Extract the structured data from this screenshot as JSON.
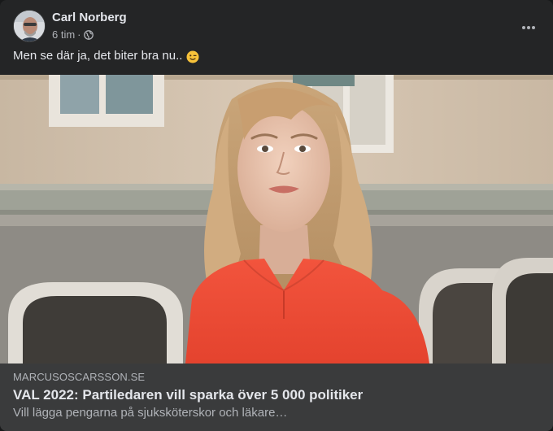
{
  "post": {
    "author": "Carl Norberg",
    "time": "6 tim",
    "separator": "·",
    "privacy_icon": "globe-icon",
    "more_icon": "more-options-icon",
    "message": "Men se där ja, det biter bra nu..",
    "emoji": "winking-face"
  },
  "link_preview": {
    "domain": "MARCUSOSCARSSON.SE",
    "title": "VAL 2022: Partiledaren vill sparka över 5 000 politiker",
    "description": "Vill lägga pengarna på sjuksköterskor och läkare…"
  },
  "colors": {
    "card_bg": "#242526",
    "link_bar_bg": "#3a3b3c",
    "primary_text": "#e4e6eb",
    "secondary_text": "#b0b3b8",
    "top_color": "#f2543d"
  }
}
